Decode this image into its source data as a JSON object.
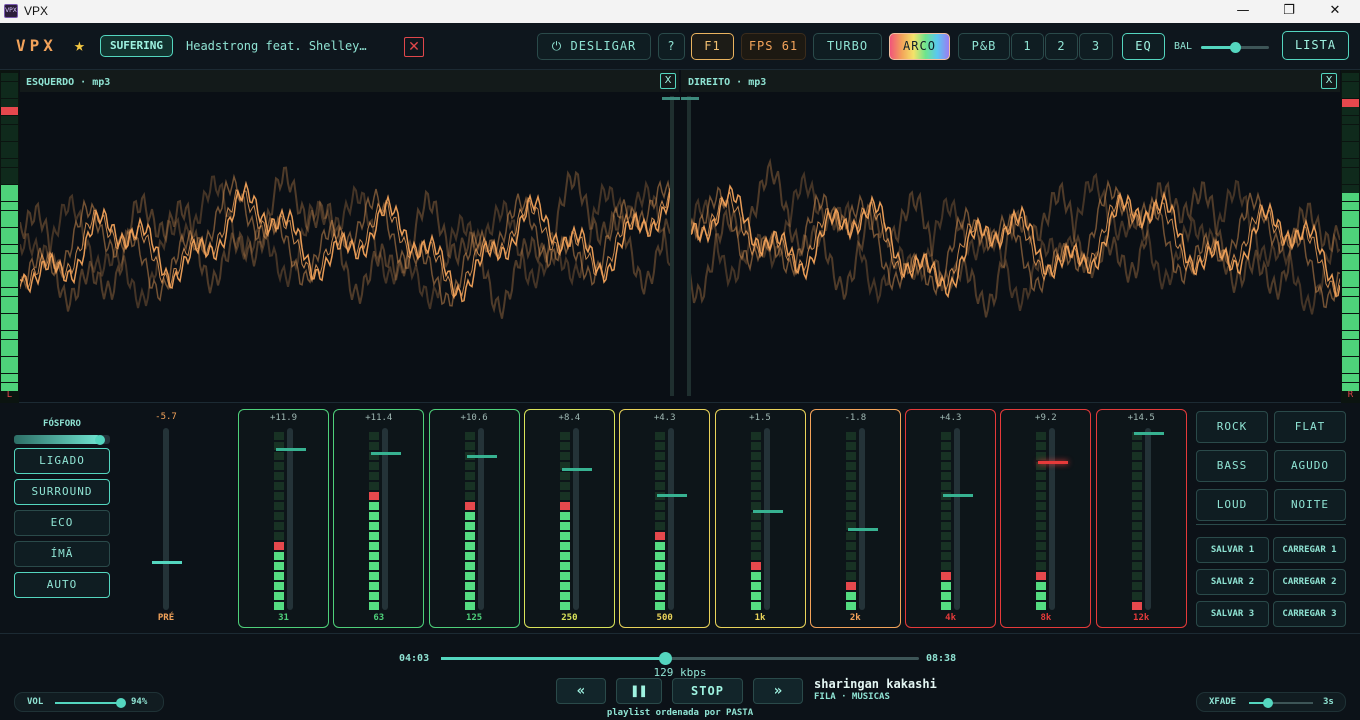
{
  "window": {
    "title": "VPX",
    "app_icon_text": "VPX"
  },
  "toolbar": {
    "logo": "VPX",
    "tag": "SUFERING",
    "track_title": "Headstrong feat. Shelley…",
    "power_label": "DESLIGAR",
    "help_label": "?",
    "f1_label": "F1",
    "fps_label": "FPS 61",
    "turbo_label": "TURBO",
    "arco_label": "ARCO",
    "pb_label": "P&B",
    "slot_1": "1",
    "slot_2": "2",
    "slot_3": "3",
    "eq_label": "EQ",
    "bal_label": "BAL",
    "bal_value": 0.5,
    "lista_label": "LISTA"
  },
  "scope": {
    "left_label": "ESQUERDO · mp3",
    "right_label": "DIREITO · mp3",
    "left_channel_letter": "L",
    "right_channel_letter": "R",
    "close_label": "X",
    "wave_color": "#f3a35a"
  },
  "controls": {
    "fosforo_label": "FÓSFORO",
    "fosforo_value": 0.9,
    "buttons": [
      "LIGADO",
      "SURROUND",
      "ECO",
      "ÍMÃ",
      "AUTO"
    ],
    "pre_value": "-5.7",
    "pre_level": 0.27,
    "pre_label": "PRÉ"
  },
  "eq": {
    "bands": [
      {
        "freq": "31",
        "gain": "+11.9",
        "color": "#4ed07a",
        "level": 0.89,
        "meter": 0.39
      },
      {
        "freq": "63",
        "gain": "+11.4",
        "color": "#4ed07a",
        "level": 0.87,
        "meter": 0.67
      },
      {
        "freq": "125",
        "gain": "+10.6",
        "color": "#4ed07a",
        "level": 0.85,
        "meter": 0.61
      },
      {
        "freq": "250",
        "gain": "+8.4",
        "color": "#d9e35a",
        "level": 0.78,
        "meter": 0.61
      },
      {
        "freq": "500",
        "gain": "+4.3",
        "color": "#e9d35a",
        "level": 0.64,
        "meter": 0.44
      },
      {
        "freq": "1k",
        "gain": "+1.5",
        "color": "#e9d35a",
        "level": 0.55,
        "meter": 0.28
      },
      {
        "freq": "2k",
        "gain": "-1.8",
        "color": "#f3a35a",
        "level": 0.45,
        "meter": 0.17
      },
      {
        "freq": "4k",
        "gain": "+4.3",
        "color": "#e53a3a",
        "level": 0.64,
        "meter": 0.22
      },
      {
        "freq": "8k",
        "gain": "+9.2",
        "color": "#e53a3a",
        "level": 0.82,
        "meter": 0.22
      },
      {
        "freq": "12k",
        "gain": "+14.5",
        "color": "#e53a3a",
        "level": 0.98,
        "meter": 0.06
      }
    ]
  },
  "presets": {
    "buttons": [
      "ROCK",
      "FLAT",
      "BASS",
      "AGUDO",
      "LOUD",
      "NOITE"
    ],
    "slots": [
      "SALVAR 1",
      "CARREGAR 1",
      "SALVAR 2",
      "CARREGAR 2",
      "SALVAR 3",
      "CARREGAR 3"
    ]
  },
  "transport": {
    "elapsed": "04:03",
    "total": "08:38",
    "progress": 0.47,
    "bitrate": "129 kbps",
    "prev_label": "«",
    "pause_label": "❚❚",
    "stop_label": "STOP",
    "next_label": "»",
    "now_playing_title": "sharingan kakashi",
    "now_playing_sub": "FILA · MUSICAS",
    "playlist_note": "playlist ordenada por PASTA",
    "vol_label": "VOL",
    "vol_value": "94%",
    "vol_level": 0.94,
    "xfade_label": "XFADE",
    "xfade_value": "3s",
    "xfade_level": 0.3
  }
}
